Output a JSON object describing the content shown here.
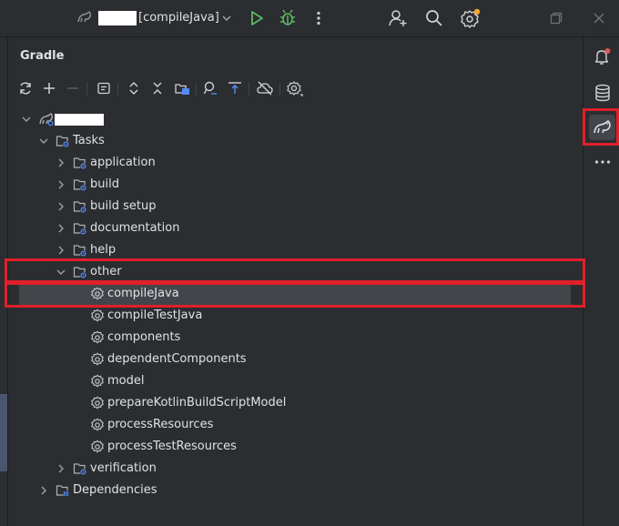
{
  "topbar": {
    "run_config": "[compileJava]",
    "icons": [
      "gradle-project-icon",
      "chevron-down-icon",
      "run-icon",
      "debug-icon",
      "more-vertical-icon",
      "add-user-icon",
      "search-icon",
      "settings-icon",
      "restore-icon",
      "close-icon"
    ]
  },
  "panel": {
    "title": "Gradle",
    "toolbar_icons": [
      "refresh-icon",
      "add-icon",
      "remove-icon",
      "execute-task-icon",
      "expand-all-icon",
      "collapse-all-icon",
      "link-project-icon",
      "analyze-icon",
      "toggle-offline-icon",
      "offline-icon",
      "build-settings-icon"
    ]
  },
  "tree": {
    "tasks_label": "Tasks",
    "groups": [
      "application",
      "build",
      "build setup",
      "documentation",
      "help"
    ],
    "other_label": "other",
    "other_tasks": [
      "compileJava",
      "compileTestJava",
      "components",
      "dependentComponents",
      "model",
      "prepareKotlinBuildScriptModel",
      "processResources",
      "processTestResources"
    ],
    "verification_label": "verification",
    "dependencies_label": "Dependencies"
  },
  "sidebar": {
    "icons": [
      "notifications-icon",
      "database-icon",
      "gradle-icon",
      "more-horizontal-icon"
    ]
  },
  "colors": {
    "background": "#2b2d30",
    "selection": "#43454a",
    "highlight_red": "#e0202a",
    "run_green": "#5fb865",
    "accent_blue": "#548af7"
  }
}
